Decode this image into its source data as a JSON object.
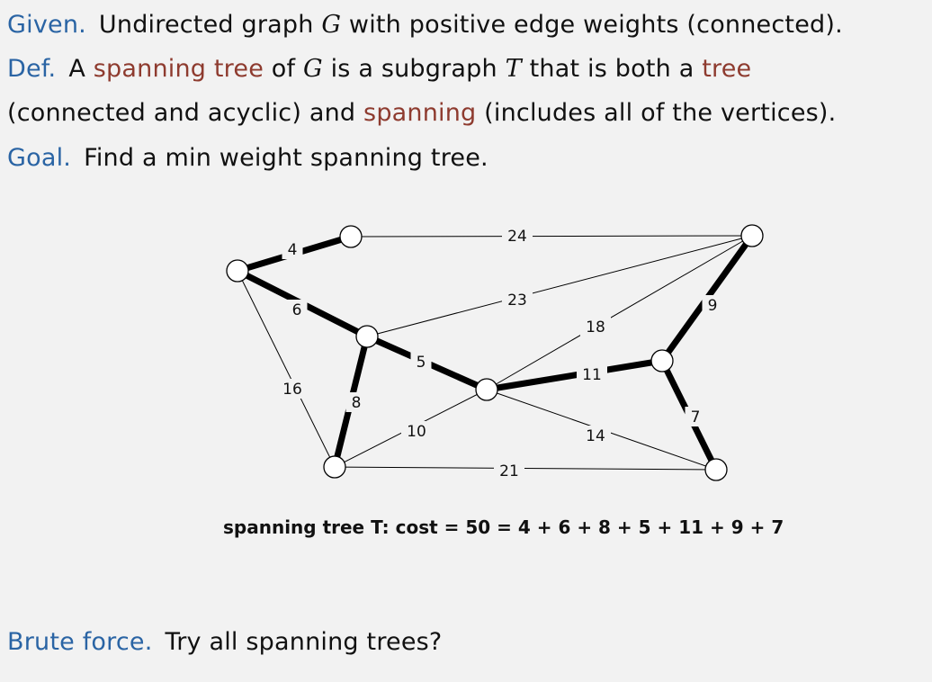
{
  "given": {
    "keyword": "Given.",
    "text1": "Undirected graph ",
    "G": "G",
    "text2": " with positive edge weights (connected)."
  },
  "def": {
    "keyword": "Def.",
    "t1": "A ",
    "term1": "spanning tree",
    "t2": " of ",
    "G": "G",
    "t3": " is a subgraph ",
    "T": "T",
    "t4": " that is both a ",
    "term2": "tree",
    "line2_a": "(connected and acyclic) and ",
    "term3": "spanning",
    "line2_b": " (includes all of the vertices)."
  },
  "goal": {
    "keyword": "Goal.",
    "text": "Find a min weight spanning tree."
  },
  "graph": {
    "edges": [
      {
        "weight": "4",
        "in_tree": true
      },
      {
        "weight": "24",
        "in_tree": false
      },
      {
        "weight": "6",
        "in_tree": true
      },
      {
        "weight": "23",
        "in_tree": false
      },
      {
        "weight": "18",
        "in_tree": false
      },
      {
        "weight": "9",
        "in_tree": true
      },
      {
        "weight": "5",
        "in_tree": true
      },
      {
        "weight": "11",
        "in_tree": true
      },
      {
        "weight": "16",
        "in_tree": false
      },
      {
        "weight": "8",
        "in_tree": true
      },
      {
        "weight": "7",
        "in_tree": true
      },
      {
        "weight": "10",
        "in_tree": false
      },
      {
        "weight": "14",
        "in_tree": false
      },
      {
        "weight": "21",
        "in_tree": false
      }
    ],
    "caption": "spanning tree T:  cost = 50 = 4 + 6 + 8 + 5 + 11 + 9 + 7"
  },
  "brute": {
    "keyword": "Brute force.",
    "text": "Try all spanning trees?"
  },
  "colors": {
    "keyword": "#2a64a4",
    "term": "#8e3b2f",
    "background": "#f2f2f2"
  }
}
